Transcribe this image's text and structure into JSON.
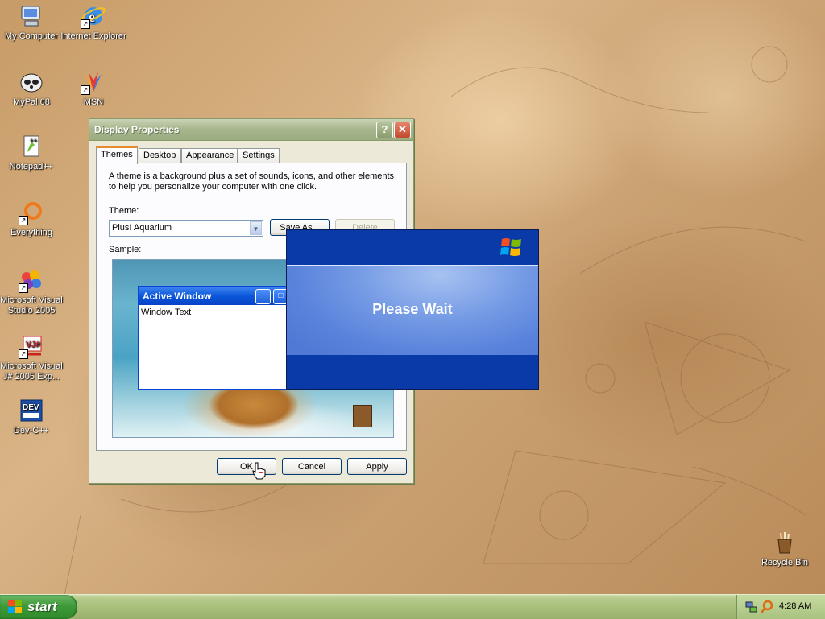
{
  "desktop": {
    "icons": [
      {
        "label": "My Computer",
        "icon": "my-computer-icon"
      },
      {
        "label": "Internet Explorer",
        "icon": "internet-explorer-icon"
      },
      {
        "label": "MyPal 68",
        "icon": "mypal-icon"
      },
      {
        "label": "MSN",
        "icon": "msn-icon"
      },
      {
        "label": "Notepad++",
        "icon": "notepad-plus-plus-icon"
      },
      {
        "label": "Everything",
        "icon": "everything-search-icon"
      },
      {
        "label": "Microsoft Visual Studio 2005",
        "icon": "visual-studio-icon"
      },
      {
        "label": "Microsoft Visual J# 2005 Exp...",
        "icon": "visual-jsharp-icon"
      },
      {
        "label": "Dev-C++",
        "icon": "dev-cpp-icon"
      },
      {
        "label": "Recycle Bin",
        "icon": "recycle-bin-icon"
      }
    ]
  },
  "dialog": {
    "title": "Display Properties",
    "help_label": "?",
    "close_label": "✕",
    "tabs": [
      {
        "label": "Themes",
        "active": true
      },
      {
        "label": "Desktop",
        "active": false
      },
      {
        "label": "Appearance",
        "active": false
      },
      {
        "label": "Settings",
        "active": false
      }
    ],
    "description": "A theme is a background plus a set of sounds, icons, and other elements to help you personalize your computer with one click.",
    "theme_label": "Theme:",
    "theme_value": "Plus! Aquarium",
    "save_as_label": "Save As...",
    "delete_label": "Delete",
    "sample_label": "Sample:",
    "preview": {
      "window_title": "Active Window",
      "window_text": "Window Text"
    },
    "ok_label": "OK",
    "cancel_label": "Cancel",
    "apply_label": "Apply"
  },
  "splash": {
    "text": "Please Wait"
  },
  "taskbar": {
    "start_label": "start",
    "clock": "4:28 AM"
  },
  "colors": {
    "xp_blue": "#0a3aa8",
    "title_olive": "#a8b78f",
    "taskbar_olive": "#a5bd78",
    "start_green": "#3f9a3a"
  }
}
